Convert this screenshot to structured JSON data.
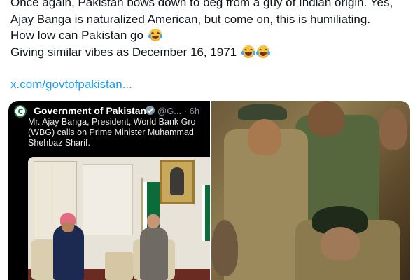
{
  "post": {
    "lines": [
      "Once again, Pakistan bows down to beg from a guy of Indian origin. Yes,",
      "Ajay Banga is naturalized American, but come on, this is humiliating.",
      "How low can Pakistan go",
      "Giving similar vibes as December 16, 1971"
    ],
    "link": "x.com/govtofpakistan..."
  },
  "embedded": {
    "name": "Government of Pakistan",
    "handle": "@G... · 6h",
    "text_lines": [
      "Mr. Ajay Banga, President, World Bank Gro",
      "(WBG) calls on Prime Minister Muhammad",
      "Shehbaz Sharif."
    ]
  },
  "icons": {
    "emoji": "face-with-tears-of-joy-icon",
    "verified": "verified-badge-icon",
    "avatar": "government-emblem-icon"
  },
  "colors": {
    "link": "#1d9bf0",
    "text": "#0f1419",
    "card_bg": "#000000",
    "flag_green": "#0c6b3a"
  }
}
